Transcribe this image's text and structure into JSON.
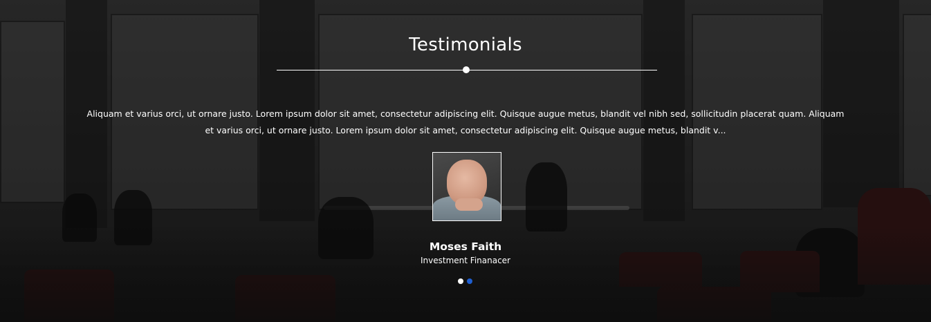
{
  "section": {
    "title": "Testimonials"
  },
  "testimonial": {
    "quote": "Aliquam et varius orci, ut ornare justo. Lorem ipsum dolor sit amet, consectetur adipiscing elit. Quisque augue metus, blandit vel nibh sed, sollicitudin placerat quam. Aliquam et varius orci, ut ornare justo. Lorem ipsum dolor sit amet, consectetur adipiscing elit. Quisque augue metus, blandit v...",
    "author_name": "Moses Faith",
    "author_role": "Investment Finanacer"
  },
  "pagination": {
    "count": 2,
    "active_index": 1,
    "inactive_color": "#ffffff",
    "active_color": "#1f5fd1"
  }
}
